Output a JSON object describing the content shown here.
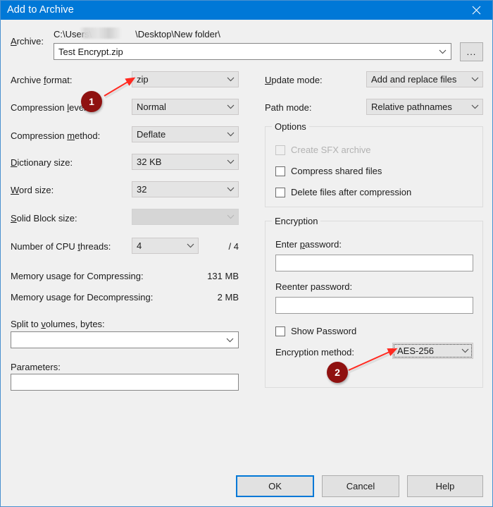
{
  "window": {
    "title": "Add to Archive",
    "close_icon": "close-icon"
  },
  "archive": {
    "label": "Archive:",
    "label_accel": "A",
    "path": "C:\\Users\\",
    "path_suffix": "\\Desktop\\New folder\\",
    "filename": "Test Encrypt.zip",
    "browse_label": "..."
  },
  "left": {
    "archive_format": {
      "label": "Archive format:",
      "value": "zip"
    },
    "compression_level": {
      "label": "Compression level:",
      "value": "Normal"
    },
    "compression_method": {
      "label": "Compression method:",
      "value": "Deflate"
    },
    "dictionary_size": {
      "label": "Dictionary size:",
      "value": "32 KB"
    },
    "word_size": {
      "label": "Word size:",
      "value": "32"
    },
    "solid_block_size": {
      "label": "Solid Block size:",
      "value": "",
      "disabled": true
    },
    "cpu_threads": {
      "label": "Number of CPU threads:",
      "value": "4",
      "total": "/ 4"
    },
    "memory_compressing": {
      "label": "Memory usage for Compressing:",
      "value": "131 MB"
    },
    "memory_decompressing": {
      "label": "Memory usage for Decompressing:",
      "value": "2 MB"
    },
    "split_volumes": {
      "label": "Split to volumes, bytes:",
      "value": ""
    },
    "parameters": {
      "label": "Parameters:",
      "value": ""
    }
  },
  "right": {
    "update_mode": {
      "label": "Update mode:",
      "value": "Add and replace files"
    },
    "path_mode": {
      "label": "Path mode:",
      "value": "Relative pathnames"
    },
    "options": {
      "title": "Options",
      "items": [
        {
          "label": "Create SFX archive",
          "checked": false,
          "disabled": true
        },
        {
          "label": "Compress shared files",
          "checked": false,
          "disabled": false
        },
        {
          "label": "Delete files after compression",
          "checked": false,
          "disabled": false
        }
      ]
    },
    "encryption": {
      "title": "Encryption",
      "enter_password_label": "Enter password:",
      "enter_password_value": "",
      "reenter_password_label": "Reenter password:",
      "reenter_password_value": "",
      "show_password_label": "Show Password",
      "show_password_checked": false,
      "method_label": "Encryption method:",
      "method_value": "AES-256"
    }
  },
  "buttons": {
    "ok": "OK",
    "cancel": "Cancel",
    "help": "Help"
  },
  "annotations": [
    {
      "number": "1"
    },
    {
      "number": "2"
    }
  ],
  "colors": {
    "titlebar": "#0078D7",
    "dialog_bg": "#F0F0F0",
    "accent_border": "#4A90CF",
    "marker_red": "#8F1110",
    "arrow_red": "#FF2A21"
  }
}
